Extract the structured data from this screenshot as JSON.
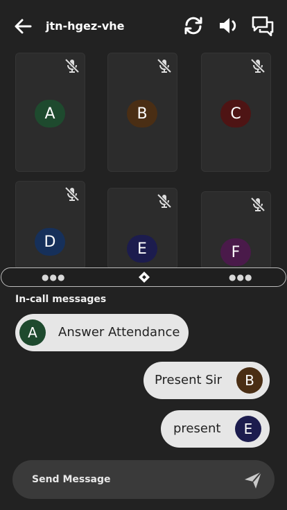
{
  "header": {
    "title": "jtn-hgez-vhe"
  },
  "participants": [
    {
      "initial": "A",
      "color": "#1e4a2e"
    },
    {
      "initial": "B",
      "color": "#4a2e14"
    },
    {
      "initial": "C",
      "color": "#4e1414"
    },
    {
      "initial": "D",
      "color": "#16305a"
    },
    {
      "initial": "E",
      "color": "#1c1c4e"
    },
    {
      "initial": "F",
      "color": "#4a1a4a"
    }
  ],
  "messages_title": "In-call messages",
  "messages": [
    {
      "initial": "A",
      "text": "Answer Attendance",
      "color": "#1e4a2e"
    },
    {
      "initial": "B",
      "text": "Present Sir",
      "color": "#4a2e14"
    },
    {
      "initial": "E",
      "text": "present",
      "color": "#1c1c4e"
    }
  ],
  "composer": {
    "placeholder": "Send Message"
  }
}
